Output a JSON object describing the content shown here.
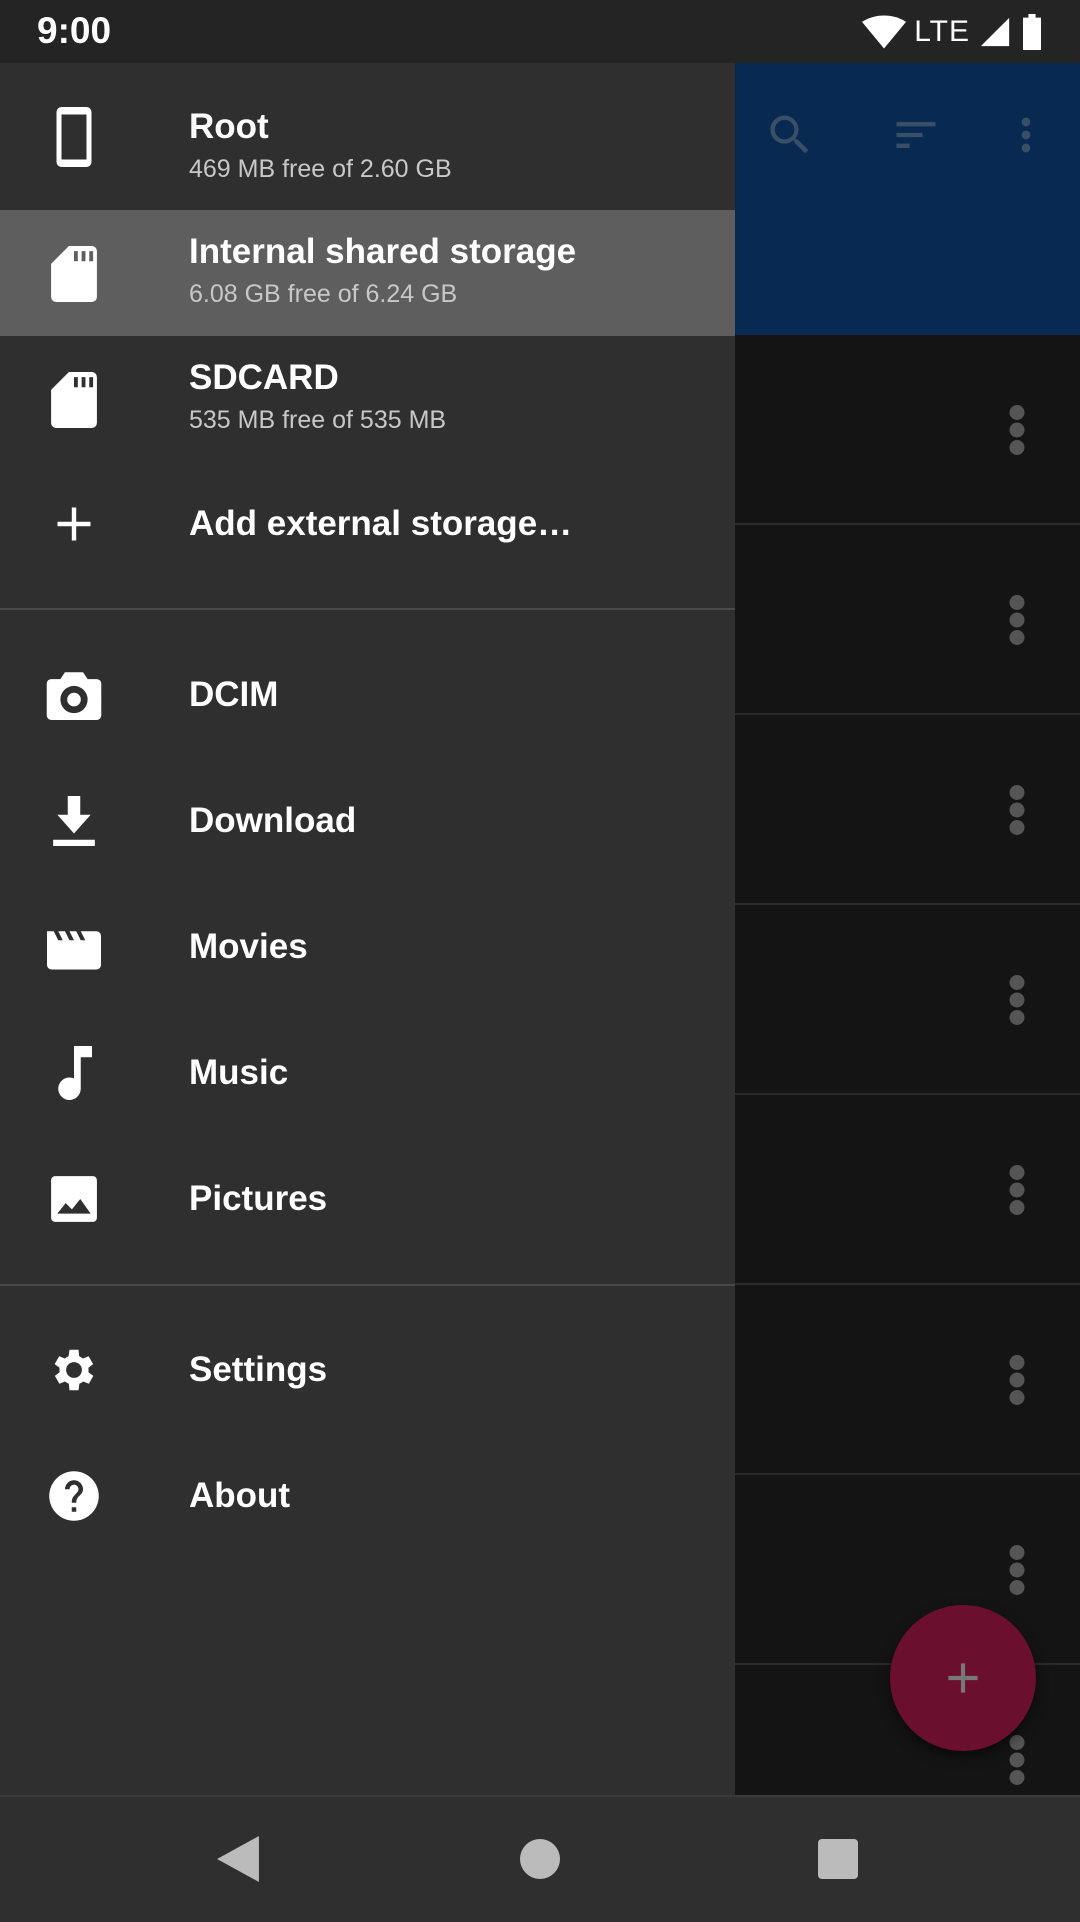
{
  "status_bar": {
    "time": "9:00",
    "network": "LTE"
  },
  "app": {
    "actions": [
      {
        "name": "search-icon"
      },
      {
        "name": "sort-icon"
      },
      {
        "name": "more-vert-icon"
      }
    ],
    "row_count": 8,
    "fab_icon": "add-icon"
  },
  "drawer": {
    "storage": [
      {
        "icon": "phone-icon",
        "title": "Root",
        "subtitle": "469 MB free of 2.60 GB"
      },
      {
        "icon": "sd-card-icon",
        "title": "Internal shared storage",
        "subtitle": "6.08 GB free of 6.24 GB",
        "selected": true
      },
      {
        "icon": "sd-card-icon",
        "title": "SDCARD",
        "subtitle": "535 MB free of 535 MB"
      },
      {
        "icon": "add-icon",
        "title": "Add external storage…"
      }
    ],
    "folders": [
      {
        "icon": "camera-icon",
        "title": "DCIM"
      },
      {
        "icon": "download-icon",
        "title": "Download"
      },
      {
        "icon": "movie-icon",
        "title": "Movies"
      },
      {
        "icon": "music-note-icon",
        "title": "Music"
      },
      {
        "icon": "image-icon",
        "title": "Pictures"
      }
    ],
    "settings": [
      {
        "icon": "settings-icon",
        "title": "Settings"
      },
      {
        "icon": "help-icon",
        "title": "About"
      }
    ]
  },
  "colors": {
    "drawer_bg": "#2f2f2f",
    "selected_bg": "#5e5e5e",
    "app_bar": "#082a52",
    "fab": "#6b0f2e"
  }
}
